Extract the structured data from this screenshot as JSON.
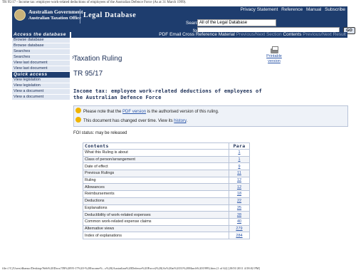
{
  "print_header": "TR 95/17 - Income tax: employee work-related deductions of employees of the Australian Defence Force (As at 31 March 1999).",
  "banner": {
    "gov_line1": "Australian Government",
    "gov_line2": "Australian Taxation Office",
    "app_title": "Legal Database",
    "util_links": [
      "Privacy Statement",
      "Reference",
      "Manual",
      "Subscribe"
    ],
    "search_label": "Search",
    "search_scope": "All of the Legal Database",
    "for_label": "for",
    "search_value": "",
    "go_label": "GO"
  },
  "sidebar": {
    "access_header": "Access the database",
    "access_items": [
      "Browse database",
      "Browse database",
      "Searches",
      "Searches",
      "View last document",
      "View last document"
    ],
    "quick_header": "Quick access",
    "quick_items": [
      "View legislation",
      "View legislation",
      "View a document",
      "View a document"
    ]
  },
  "toolbar": {
    "pdf": "PDF",
    "email": "Email",
    "cross_ref": "Cross Reference Material",
    "prev_next_section": "Previous/Next Section",
    "contents": "Contents",
    "prev_next_result": "Previous/Next Result"
  },
  "document": {
    "ruling_title": "Taxation Ruling",
    "ruling_number": "TR 95/17",
    "printable_line1": "Printable",
    "printable_line2": "version",
    "subject": "Income tax: employee work-related deductions of employees of the Australian Defence Force",
    "notice1_pre": "Please note that the",
    "notice1_link": "PDF version",
    "notice1_post": "is the authorised version of this ruling.",
    "notice2_pre": "This document has changed over time. View its",
    "notice2_link": "history",
    "notice2_post": ".",
    "foi": "FOI status: may be released"
  },
  "contents_table": {
    "headers": [
      "Contents",
      "Para"
    ],
    "rows": [
      {
        "label": "What this Ruling is about",
        "para": "1"
      },
      {
        "label": "Class of person/arrangement",
        "para": "1"
      },
      {
        "label": "Date of effect",
        "para": "9"
      },
      {
        "label": "Previous Rulings",
        "para": "11"
      },
      {
        "label": "Ruling",
        "para": "12"
      },
      {
        "label": "Allowances",
        "para": "12"
      },
      {
        "label": "Reimbursements",
        "para": "18"
      },
      {
        "label": "Deductions",
        "para": "22"
      },
      {
        "label": "Explanations",
        "para": "25"
      },
      {
        "label": "Deductibility of work-related expenses",
        "para": "28"
      },
      {
        "label": "Common work-related expense claims",
        "para": "40"
      },
      {
        "label": "Alternative views",
        "para": "279"
      },
      {
        "label": "Index of explanations",
        "para": "284"
      }
    ]
  },
  "print_footer": "file:///C|/Users/dbanso/Desktop/Web%20Docs/TR%2095-17%20-%20Income%...s%20(Australian%20Defence%20Force)%20(As%20at%2031%20March%201999).htm (1 of 62) [20/01/2011 4:58:02 PM]"
}
